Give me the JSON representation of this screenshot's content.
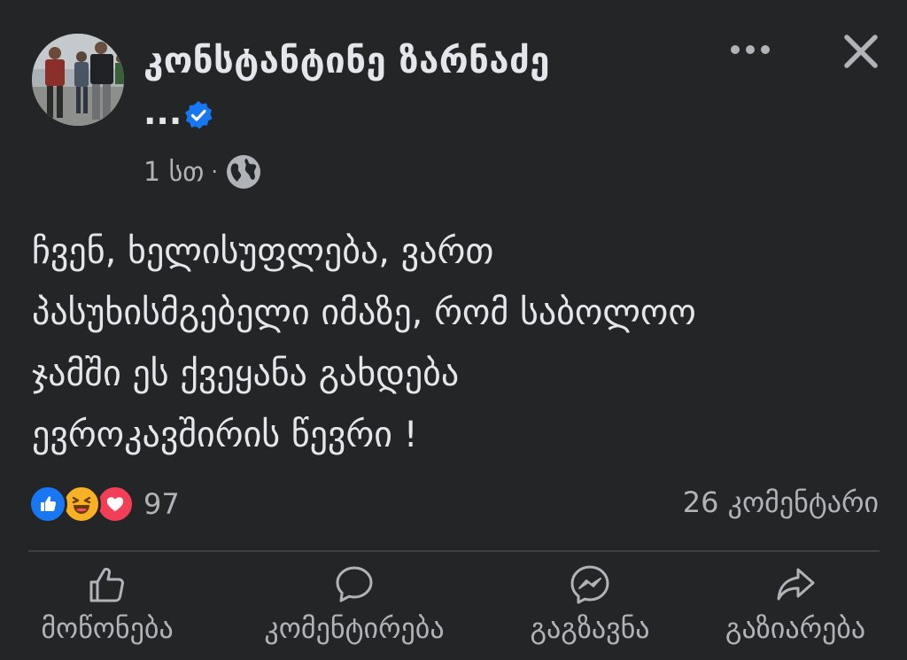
{
  "author": {
    "name": "კონსტანტინე ზარნაძე",
    "name_overflow": "...",
    "verified": true
  },
  "meta": {
    "time": "1 სთ",
    "separator": "·",
    "audience_icon": "globe-icon"
  },
  "header_actions": {
    "more_icon": "more-horizontal-icon",
    "close_icon": "close-icon"
  },
  "post": {
    "text": "ჩვენ, ხელისუფლება, ვართ\nპასუხისმგებელი იმაზე, რომ საბოლოო\nჯამში ეს ქვეყანა გახდება\nევროკავშირის წევრი !"
  },
  "stats": {
    "reaction_icons": [
      "like-reaction-icon",
      "haha-reaction-icon",
      "love-reaction-icon"
    ],
    "reactions": "97",
    "comments": "26 კომენტარი"
  },
  "actions": {
    "like": "მოწონება",
    "comment": "კომენტირება",
    "send": "გაგზავნა",
    "share": "გაზიარება"
  },
  "colors": {
    "background": "#242526",
    "text_primary": "#e4e6eb",
    "text_secondary": "#b0b3b8",
    "accent": "#1877f2",
    "love": "#f33e58",
    "haha": "#f7b125"
  }
}
